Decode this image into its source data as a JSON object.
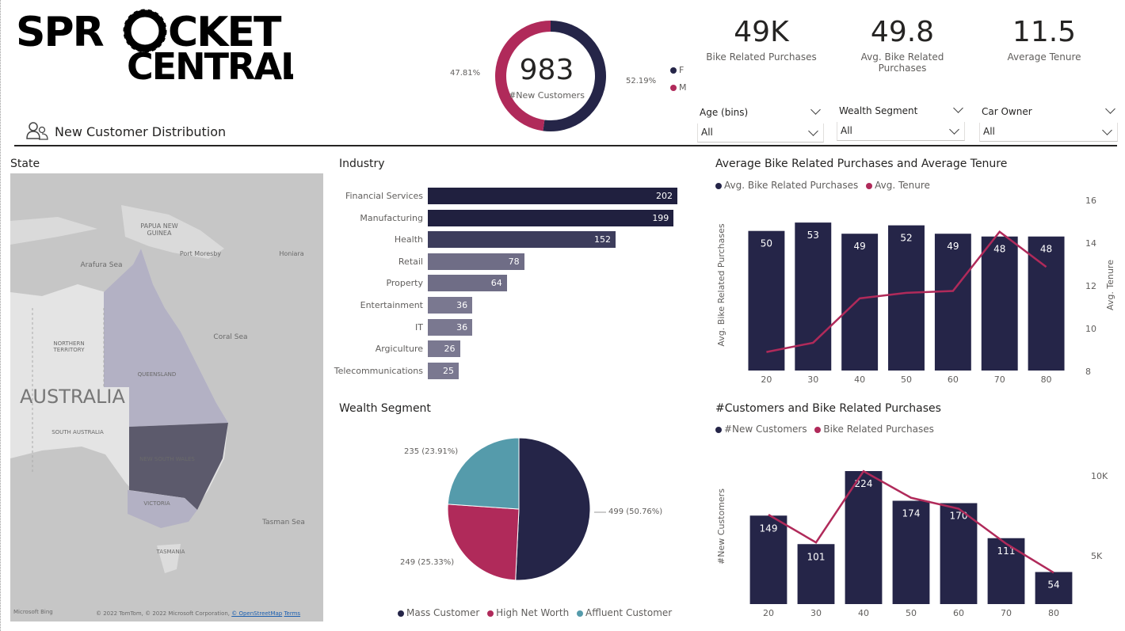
{
  "logo": {
    "line1": "SPROCKET",
    "line2": "CENTRAL"
  },
  "header": {
    "section_title": "New Customer Distribution",
    "icon": "people-icon"
  },
  "donut": {
    "value": "983",
    "label": "#New Customers",
    "left_pct": "47.81%",
    "right_pct": "52.19%",
    "legend": [
      {
        "label": "F",
        "color": "#252548"
      },
      {
        "label": "M",
        "color": "#b02a5a"
      }
    ],
    "f_fraction": 0.5219,
    "m_fraction": 0.4781
  },
  "kpis": [
    {
      "value": "49K",
      "label": "Bike Related Purchases"
    },
    {
      "value": "49.8",
      "label": "Avg. Bike Related Purchases"
    },
    {
      "value": "11.5",
      "label": "Average Tenure"
    }
  ],
  "slicers": [
    {
      "title": "Age (bins)",
      "value": "All"
    },
    {
      "title": "Wealth Segment",
      "value": "All"
    },
    {
      "title": "Car Owner",
      "value": "All"
    }
  ],
  "map": {
    "title": "State",
    "labels": {
      "png": "PAPUA NEW GUINEA",
      "port_moresby": "Port Moresby",
      "honiara": "Honiara",
      "arafura": "Arafura Sea",
      "coral": "Coral Sea",
      "nt": "NORTHERN TERRITORY",
      "qld": "QUEENSLAND",
      "australia": "AUSTRALIA",
      "sa": "SOUTH AUSTRALIA",
      "nsw": "NEW SOUTH WALES",
      "vic": "VICTORIA",
      "tasman": "Tasman Sea",
      "tas": "TASMANIA",
      "bing": "Microsoft Bing",
      "credits": "© 2022 TomTom, © 2022 Microsoft Corporation,",
      "osm": "© OpenStreetMap",
      "terms": "Terms"
    }
  },
  "colors": {
    "navy": "#252548",
    "crimson": "#b02a5a",
    "teal": "#559bab",
    "bar_dark": "#20203f",
    "bar_mid": "#3d3d5c",
    "bar_light": "#7a7890"
  },
  "chart_data": [
    {
      "type": "bar",
      "title": "Industry",
      "orientation": "horizontal",
      "categories": [
        "Financial Services",
        "Manufacturing",
        "Health",
        "Retail",
        "Property",
        "Entertainment",
        "IT",
        "Argiculture",
        "Telecommunications"
      ],
      "values": [
        202,
        199,
        152,
        78,
        64,
        36,
        36,
        26,
        25
      ]
    },
    {
      "type": "pie",
      "title": "Wealth Segment",
      "categories": [
        "Mass Customer",
        "High Net Worth",
        "Affluent Customer"
      ],
      "values": [
        499,
        249,
        235
      ],
      "data_labels": [
        "499 (50.76%)",
        "249 (25.33%)",
        "235 (23.91%)"
      ],
      "colors": [
        "#252548",
        "#b02a5a",
        "#559bab"
      ]
    },
    {
      "type": "bar",
      "title": "Average Bike Related Purchases and Average Tenure",
      "categories": [
        "20",
        "30",
        "40",
        "50",
        "60",
        "70",
        "80"
      ],
      "series": [
        {
          "name": "Avg. Bike Related Purchases",
          "type": "bar",
          "values": [
            50,
            53,
            49,
            52,
            49,
            48,
            48
          ],
          "color": "#252548"
        },
        {
          "name": "Avg. Tenure",
          "type": "line",
          "values": [
            8.6,
            9.1,
            11.5,
            11.8,
            11.9,
            15.1,
            13.2
          ],
          "color": "#b02a5a"
        }
      ],
      "ylabel": "Avg. Bike Related Purchases",
      "y2label": "Avg. Tenure",
      "y2_ticks": [
        "16",
        "14",
        "12",
        "10",
        "8"
      ],
      "y2lim": [
        8,
        16
      ],
      "ylim": [
        0,
        58
      ],
      "legend_position": "top-left"
    },
    {
      "type": "bar",
      "title": "#Customers and Bike Related Purchases",
      "categories": [
        "20",
        "30",
        "40",
        "50",
        "60",
        "70",
        "80"
      ],
      "series": [
        {
          "name": "#New Customers",
          "type": "bar",
          "values": [
            149,
            101,
            224,
            174,
            170,
            111,
            54
          ],
          "color": "#252548"
        },
        {
          "name": "Bike Related Purchases",
          "type": "line",
          "values": [
            7400,
            5100,
            11000,
            8800,
            7900,
            5000,
            2600
          ],
          "color": "#b02a5a"
        }
      ],
      "ylabel": "#New Customers",
      "y2_ticks": [
        "10K",
        "5K"
      ],
      "y2lim": [
        0,
        12000
      ],
      "ylim": [
        0,
        240
      ],
      "legend_position": "top-left"
    }
  ]
}
